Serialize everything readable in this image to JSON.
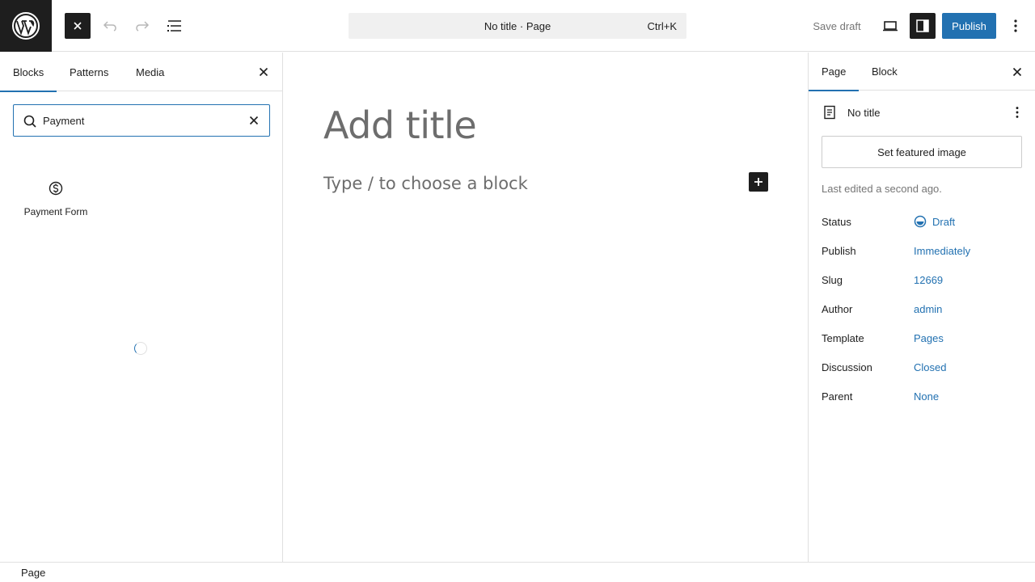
{
  "toolbar": {
    "command_title": "No title · Page",
    "command_shortcut": "Ctrl+K",
    "save_draft_label": "Save draft",
    "publish_label": "Publish",
    "accent_color": "#2271b1"
  },
  "inserter": {
    "tabs": [
      {
        "label": "Blocks",
        "active": true
      },
      {
        "label": "Patterns",
        "active": false
      },
      {
        "label": "Media",
        "active": false
      }
    ],
    "search_value": "Payment",
    "results": [
      {
        "label": "Payment Form",
        "icon": "dollar-icon"
      }
    ]
  },
  "canvas": {
    "title_placeholder": "Add title",
    "paragraph_placeholder": "Type / to choose a block"
  },
  "settings": {
    "tabs": [
      {
        "label": "Page",
        "active": true
      },
      {
        "label": "Block",
        "active": false
      }
    ],
    "document_title": "No title",
    "featured_image_label": "Set featured image",
    "last_edited": "Last edited a second ago.",
    "meta": [
      {
        "label": "Status",
        "value": "Draft"
      },
      {
        "label": "Publish",
        "value": "Immediately"
      },
      {
        "label": "Slug",
        "value": "12669"
      },
      {
        "label": "Author",
        "value": "admin"
      },
      {
        "label": "Template",
        "value": "Pages"
      },
      {
        "label": "Discussion",
        "value": "Closed"
      },
      {
        "label": "Parent",
        "value": "None"
      }
    ]
  },
  "footer": {
    "breadcrumb": "Page"
  }
}
